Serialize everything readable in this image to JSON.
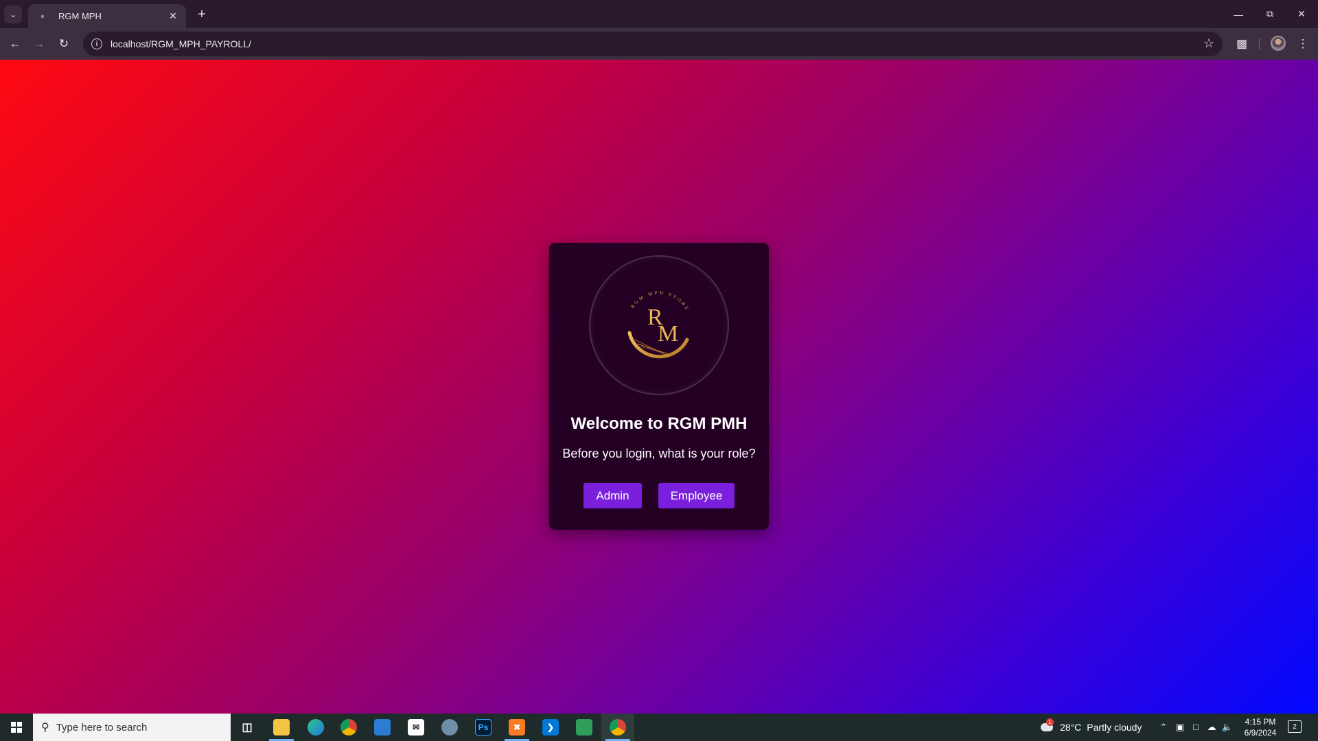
{
  "browser": {
    "tab_title": "RGM MPH",
    "url": "localhost/RGM_MPH_PAYROLL/",
    "tab_search_icon": "chevron-down-icon",
    "new_tab_icon": "plus-icon"
  },
  "page": {
    "logo": {
      "monogram_top": "R",
      "monogram_bottom": "M",
      "ring_text": "RGM MPH STORE"
    },
    "title": "Welcome to RGM PMH",
    "subtitle": "Before you login, what is your role?",
    "buttons": {
      "admin": "Admin",
      "employee": "Employee"
    },
    "colors": {
      "button": "#7a1fdc",
      "card": "#230024",
      "gradient_start": "#ff0a12",
      "gradient_end": "#0008ff",
      "logo_gold": "#d9a441"
    }
  },
  "taskbar": {
    "search_placeholder": "Type here to search",
    "weather": {
      "temp": "28°C",
      "condition": "Partly cloudy"
    },
    "clock": {
      "time": "4:15 PM",
      "date": "6/9/2024"
    },
    "notification_count": "2",
    "weather_badge": "1"
  }
}
